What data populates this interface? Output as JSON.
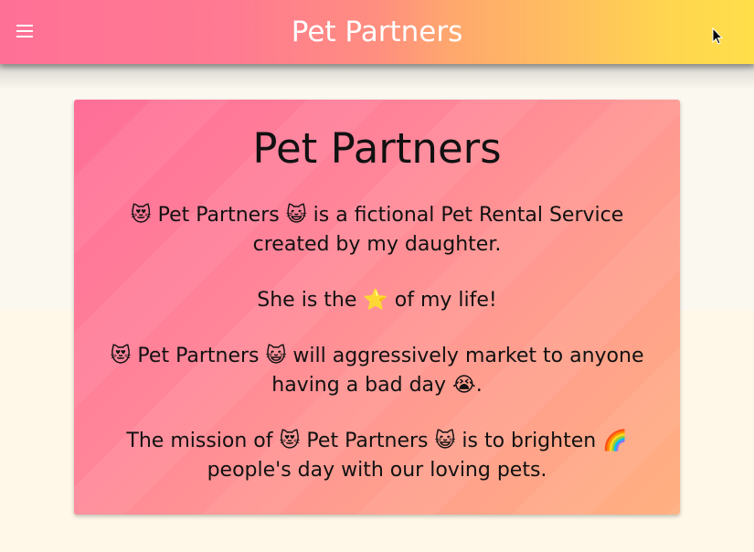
{
  "toolbar": {
    "title": "Pet Partners",
    "menu_icon": "menu-icon",
    "theme_icon": "moon-icon"
  },
  "card": {
    "title": "Pet Partners",
    "paragraphs": [
      "😻 Pet Partners 😺 is a fictional Pet Rental Service created by my daughter.",
      "She is the ⭐ of my life!",
      "😻 Pet Partners 😺 will aggressively market to anyone having a bad day 😭.",
      "The mission of 😻 Pet Partners 😺 is to brighten 🌈 people's day with our loving pets."
    ]
  },
  "colors": {
    "toolbar_start": "#ff7096",
    "toolbar_end": "#ffdf4a",
    "card_start": "#ff6e98",
    "card_end": "#ffb080",
    "text": "#111111"
  }
}
